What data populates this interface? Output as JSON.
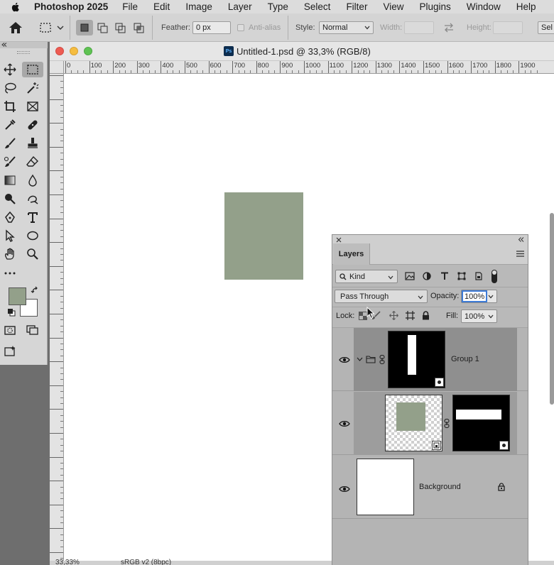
{
  "menubar": {
    "app_name": "Photoshop 2025",
    "items": [
      "File",
      "Edit",
      "Image",
      "Layer",
      "Type",
      "Select",
      "Filter",
      "View",
      "Plugins",
      "Window",
      "Help"
    ]
  },
  "options": {
    "feather_label": "Feather:",
    "feather_value": "0 px",
    "antialias_label": "Anti-alias",
    "style_label": "Style:",
    "style_value": "Normal",
    "width_label": "Width:",
    "height_label": "Height:",
    "select_label": "Sel"
  },
  "document": {
    "title": "Untitled-1.psd @ 33,3% (RGB/8)",
    "ruler_labels": [
      "0",
      "100",
      "200",
      "300",
      "400",
      "500",
      "600",
      "700",
      "800",
      "900",
      "1000",
      "1100",
      "1200",
      "1300",
      "1400",
      "1500",
      "1600",
      "1700",
      "1800",
      "1900"
    ],
    "zoom": "33,33%",
    "color_profile": "sRGB v2 (8bpc)"
  },
  "colors": {
    "foreground": "#93a08a",
    "background": "#ffffff",
    "rect_fill": "#93a08a"
  },
  "layers_panel": {
    "tab_label": "Layers",
    "kind_label": "Kind",
    "blend_mode": "Pass Through",
    "opacity_label": "Opacity:",
    "opacity_value": "100%",
    "lock_label": "Lock:",
    "fill_label": "Fill:",
    "fill_value": "100%",
    "layers": [
      {
        "name": "Group 1",
        "type": "group"
      },
      {
        "name": "",
        "type": "layer-with-mask"
      },
      {
        "name": "Background",
        "type": "background"
      }
    ]
  }
}
